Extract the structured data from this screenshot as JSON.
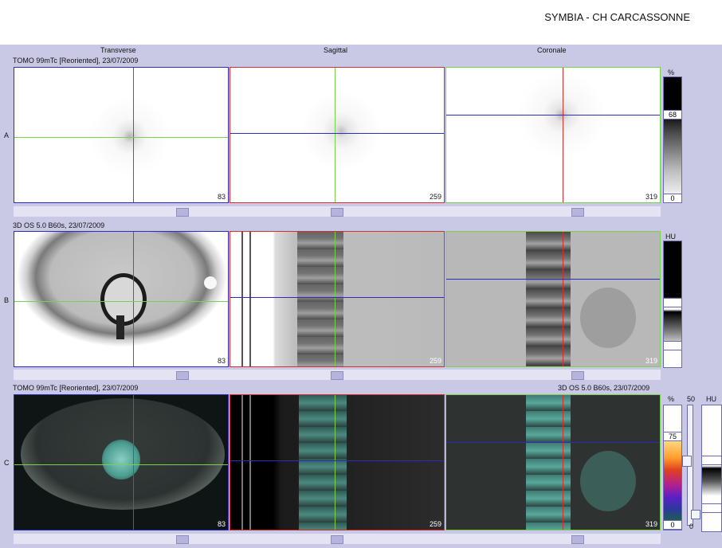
{
  "header": {
    "title": "SYMBIA - CH CARCASSONNE"
  },
  "columns": {
    "transverse": "Transverse",
    "sagittal": "Sagittal",
    "coronal": "Coronale"
  },
  "rows": {
    "a": {
      "label": "A",
      "series": "TOMO 99mTc [Reoriented], 23/07/2009",
      "unit": "%",
      "max": "68",
      "min": "0",
      "slices": {
        "transverse": "83",
        "sagittal": "259",
        "coronal": "319"
      }
    },
    "b": {
      "label": "B",
      "series": "3D  OS  5.0  B60s, 23/07/2009",
      "unit": "HU",
      "slices": {
        "transverse": "83",
        "sagittal": "259",
        "coronal": "319"
      }
    },
    "c": {
      "label": "C",
      "series_left": "TOMO 99mTc [Reoriented], 23/07/2009",
      "series_right": "3D  OS  5.0  B60s, 23/07/2009",
      "unit_left": "%",
      "value_50": "50",
      "unit_right": "HU",
      "max": "75",
      "min": "0",
      "min_small": "0",
      "slices": {
        "transverse": "83",
        "sagittal": "259",
        "coronal": "319"
      }
    }
  },
  "colors": {
    "red": "#d03030",
    "green": "#79d24a",
    "blue": "#2c2cc0",
    "background": "#c9c9e6"
  }
}
